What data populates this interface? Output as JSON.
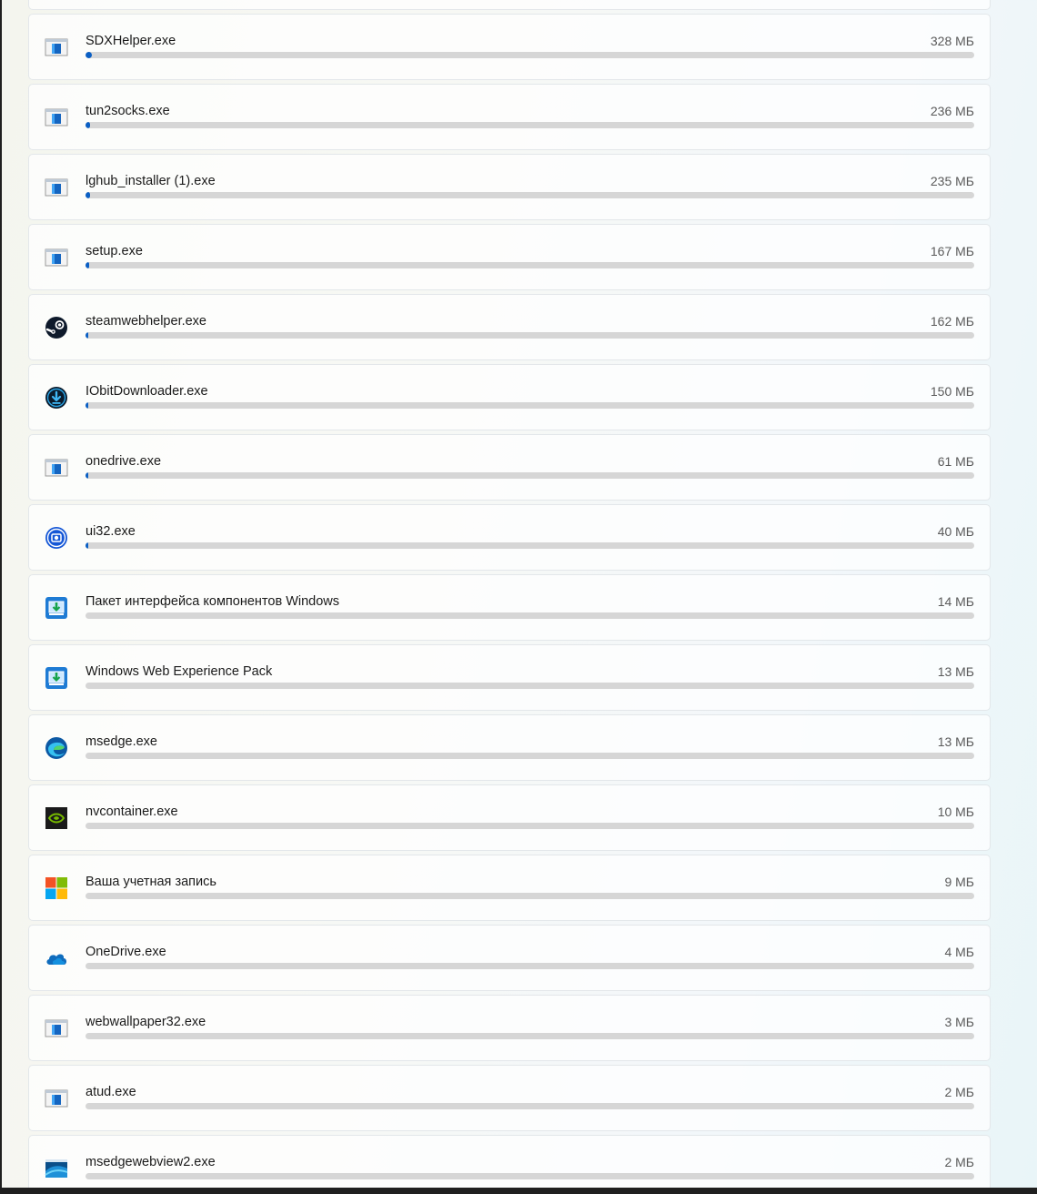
{
  "colors": {
    "accent": "#0a5fc4",
    "track": "#d6d6d6"
  },
  "apps": [
    {
      "name": "",
      "size": "",
      "icon": "blank-icon",
      "usage": 0
    },
    {
      "name": "SDXHelper.exe",
      "size": "328 МБ",
      "icon": "app-window-icon",
      "usage": 0.007
    },
    {
      "name": "tun2socks.exe",
      "size": "236 МБ",
      "icon": "app-window-icon",
      "usage": 0.005
    },
    {
      "name": "lghub_installer (1).exe",
      "size": "235 МБ",
      "icon": "app-window-icon",
      "usage": 0.005
    },
    {
      "name": "setup.exe",
      "size": "167 МБ",
      "icon": "app-window-icon",
      "usage": 0.004
    },
    {
      "name": "steamwebhelper.exe",
      "size": "162 МБ",
      "icon": "steam-icon",
      "usage": 0.003
    },
    {
      "name": "IObitDownloader.exe",
      "size": "150 МБ",
      "icon": "download-circle-icon",
      "usage": 0.003
    },
    {
      "name": "onedrive.exe",
      "size": "61 МБ",
      "icon": "app-window-icon",
      "usage": 0.0015
    },
    {
      "name": "ui32.exe",
      "size": "40 МБ",
      "icon": "capture-circle-icon",
      "usage": 0.001
    },
    {
      "name": "Пакет интерфейса компонентов Windows",
      "size": "14 МБ",
      "icon": "package-install-icon",
      "usage": 0
    },
    {
      "name": "Windows Web Experience Pack",
      "size": "13 МБ",
      "icon": "package-install-icon",
      "usage": 0
    },
    {
      "name": "msedge.exe",
      "size": "13 МБ",
      "icon": "edge-icon",
      "usage": 0
    },
    {
      "name": "nvcontainer.exe",
      "size": "10 МБ",
      "icon": "nvidia-icon",
      "usage": 0
    },
    {
      "name": "Ваша учетная запись",
      "size": "9 МБ",
      "icon": "microsoft-logo-icon",
      "usage": 0
    },
    {
      "name": "OneDrive.exe",
      "size": "4 МБ",
      "icon": "cloud-icon",
      "usage": 0
    },
    {
      "name": "webwallpaper32.exe",
      "size": "3 МБ",
      "icon": "app-window-icon",
      "usage": 0
    },
    {
      "name": "atud.exe",
      "size": "2 МБ",
      "icon": "app-window-icon",
      "usage": 0
    },
    {
      "name": "msedgewebview2.exe",
      "size": "2 МБ",
      "icon": "webview-icon",
      "usage": 0
    }
  ]
}
